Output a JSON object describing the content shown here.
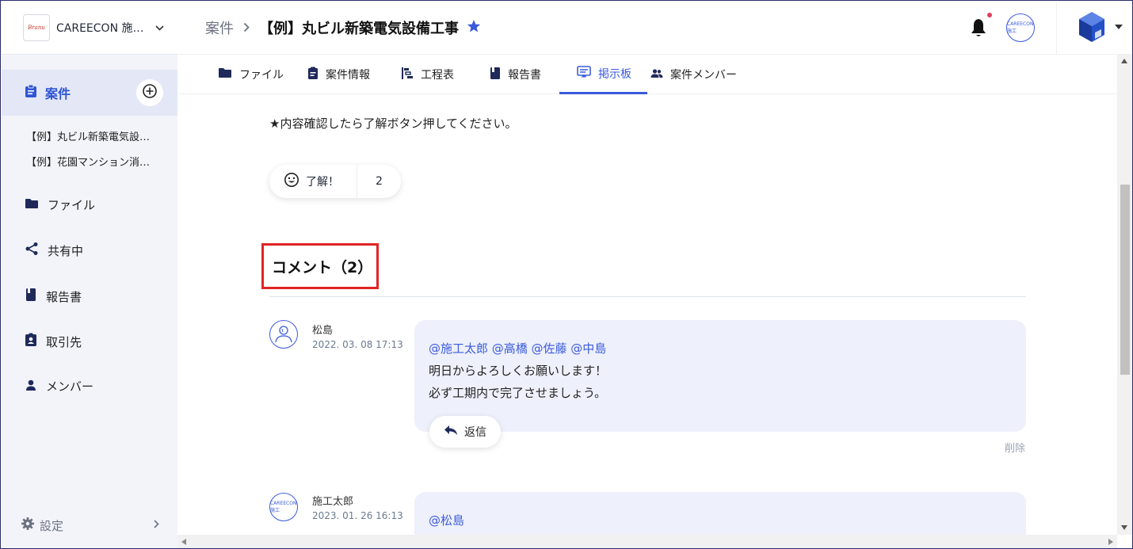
{
  "brand": {
    "logo_text": "Branu",
    "name": "CAREECON 施…"
  },
  "sidebar": {
    "active_label": "案件",
    "projects": [
      "【例】丸ビル新築電気設…",
      "【例】花園マンション消…"
    ],
    "items": [
      {
        "label": "ファイル",
        "icon": "folder-icon"
      },
      {
        "label": "共有中",
        "icon": "share-icon"
      },
      {
        "label": "報告書",
        "icon": "book-icon"
      },
      {
        "label": "取引先",
        "icon": "badge-icon"
      },
      {
        "label": "メンバー",
        "icon": "person-icon"
      }
    ],
    "settings_label": "設定"
  },
  "header": {
    "breadcrumb_root": "案件",
    "title": "【例】丸ビル新築電気設備工事",
    "avatar_text": "CAREECON 施工"
  },
  "tabs": [
    {
      "label": "ファイル",
      "icon": "folder-icon"
    },
    {
      "label": "案件情報",
      "icon": "clipboard-icon"
    },
    {
      "label": "工程表",
      "icon": "gantt-icon"
    },
    {
      "label": "報告書",
      "icon": "book-icon"
    },
    {
      "label": "掲示板",
      "icon": "board-icon",
      "active": true
    },
    {
      "label": "案件メンバー",
      "icon": "people-icon"
    }
  ],
  "post": {
    "notice": "★内容確認したら了解ボタン押してください。",
    "reaction_label": "了解！",
    "reaction_count": "2"
  },
  "comments": {
    "heading": "コメント（2）",
    "items": [
      {
        "author": "松島",
        "date": "2022. 03. 08 17:13",
        "mentions": "@施工太郎 @高橋 @佐藤 @中島",
        "line1": "明日からよろしくお願いします！",
        "line2": "必ず工期内で完了させましょう。",
        "reply_label": "返信",
        "delete_label": "削除"
      },
      {
        "author": "施工太郎",
        "date": "2023. 01. 26 16:13",
        "avatar_text": "CAREECON 施工",
        "mentions": "@松島"
      }
    ]
  },
  "colors": {
    "accent": "#3b5bdb",
    "highlight_border": "#e02424",
    "notification_dot": "#e23d5e"
  }
}
